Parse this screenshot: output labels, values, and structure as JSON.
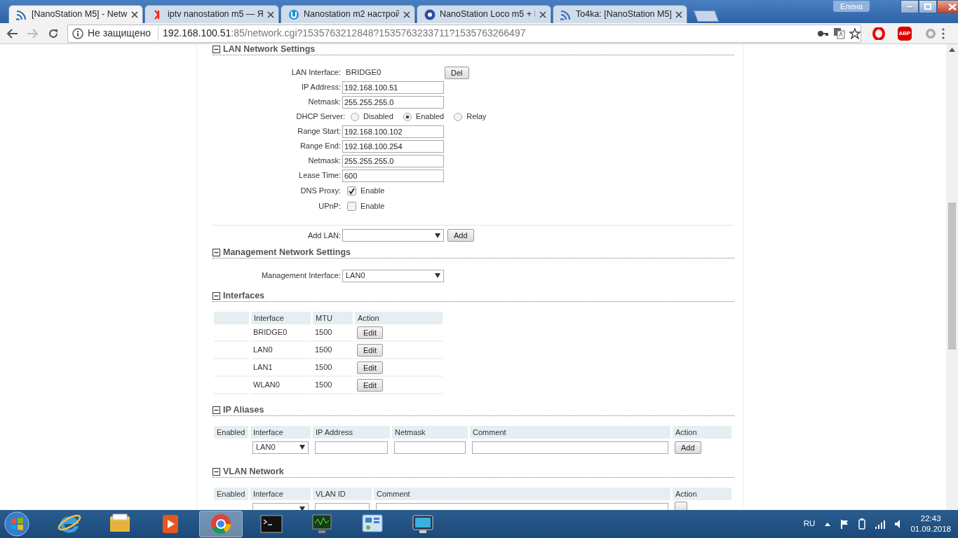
{
  "browser": {
    "tabs": [
      {
        "title": "[NanoStation M5] - Netw",
        "selected": true
      },
      {
        "title": "iptv nanostation m5 — Я",
        "selected": false
      },
      {
        "title": "Nanostation m2 настрой",
        "selected": false
      },
      {
        "title": "NanoStation Loco m5 + I",
        "selected": false
      },
      {
        "title": "To4ka: [NanoStation M5]",
        "selected": false
      }
    ],
    "user": "Елена",
    "address": {
      "security": "Не защищено",
      "host": "192.168.100.51",
      "path": ":85/network.cgi?1535763212848?1535763233711?1535763266497"
    },
    "extensions": [
      {
        "kind": "opera"
      },
      {
        "kind": "abp",
        "label": "ABP"
      },
      {
        "kind": "ghost"
      }
    ]
  },
  "sections": [
    {
      "title": "LAN Network Settings",
      "kind": "form",
      "expanded": true,
      "rows": [
        {
          "kind": "static",
          "label": "LAN Interface:",
          "value": "BRIDGE0",
          "button": "Del"
        },
        {
          "kind": "input",
          "label": "IP Address:",
          "value": "192.168.100.51"
        },
        {
          "kind": "input",
          "label": "Netmask:",
          "value": "255.255.255.0"
        },
        {
          "kind": "radio",
          "label": "DHCP Server:",
          "options": [
            {
              "label": "Disabled",
              "selected": false
            },
            {
              "label": "Enabled",
              "selected": true
            },
            {
              "label": "Relay",
              "selected": false
            }
          ]
        },
        {
          "kind": "input",
          "label": "Range Start:",
          "value": "192.168.100.102"
        },
        {
          "kind": "input",
          "label": "Range End:",
          "value": "192.168.100.254"
        },
        {
          "kind": "input",
          "label": "Netmask:",
          "value": "255.255.255.0"
        },
        {
          "kind": "input",
          "label": "Lease Time:",
          "value": "600"
        },
        {
          "kind": "checkbox",
          "label": "DNS Proxy:",
          "text": "Enable",
          "checked": true
        },
        {
          "kind": "checkbox",
          "label": "UPnP:",
          "text": "Enable",
          "checked": false
        },
        {
          "kind": "select",
          "label": "Add LAN:",
          "button": "Add",
          "separated": true
        }
      ]
    },
    {
      "title": "Management Network Settings",
      "kind": "form",
      "expanded": true,
      "rows": [
        {
          "kind": "select",
          "label": "Management Interface:",
          "value": "LAN0"
        }
      ]
    },
    {
      "title": "Interfaces",
      "kind": "interfaces",
      "expanded": true,
      "columns": [
        "",
        "Interface",
        "MTU",
        "Action"
      ],
      "rows": [
        {
          "cells": [
            {
              "kind": "spacer"
            },
            {
              "kind": "text",
              "text": "BRIDGE0"
            },
            {
              "kind": "text",
              "text": "1500"
            },
            {
              "kind": "button",
              "text": "Edit"
            }
          ]
        },
        {
          "cells": [
            {
              "kind": "spacer"
            },
            {
              "kind": "text",
              "text": "LAN0"
            },
            {
              "kind": "text",
              "text": "1500"
            },
            {
              "kind": "button",
              "text": "Edit"
            }
          ]
        },
        {
          "cells": [
            {
              "kind": "spacer"
            },
            {
              "kind": "text",
              "text": "LAN1"
            },
            {
              "kind": "text",
              "text": "1500"
            },
            {
              "kind": "button",
              "text": "Edit"
            }
          ]
        },
        {
          "cells": [
            {
              "kind": "spacer"
            },
            {
              "kind": "text",
              "text": "WLAN0"
            },
            {
              "kind": "text",
              "text": "1500"
            },
            {
              "kind": "button",
              "text": "Edit"
            }
          ]
        }
      ]
    },
    {
      "title": "IP Aliases",
      "kind": "aliases",
      "expanded": true,
      "columns": [
        "Enabled",
        "Interface",
        "IP Address",
        "Netmask",
        "Comment",
        "Action"
      ],
      "rows": [
        {
          "cells": [
            {
              "kind": "blank"
            },
            {
              "kind": "select",
              "text": "LAN0"
            },
            {
              "kind": "input"
            },
            {
              "kind": "input"
            },
            {
              "kind": "input"
            },
            {
              "kind": "button",
              "text": "Add"
            }
          ]
        }
      ]
    },
    {
      "title": "VLAN Network",
      "kind": "vlan",
      "expanded": true,
      "columns": [
        "Enabled",
        "Interface",
        "VLAN ID",
        "Comment",
        "Action"
      ],
      "rows": [
        {
          "cells": [
            {
              "kind": "blank"
            },
            {
              "kind": "select"
            },
            {
              "kind": "input"
            },
            {
              "kind": "input"
            },
            {
              "kind": "button"
            }
          ]
        }
      ]
    }
  ],
  "taskbar": {
    "apps": [
      {
        "kind": "ie",
        "selected": false
      },
      {
        "kind": "explorer",
        "selected": false
      },
      {
        "kind": "media",
        "selected": false
      },
      {
        "kind": "chrome",
        "selected": true
      },
      {
        "kind": "cmd",
        "selected": false
      },
      {
        "kind": "monitor",
        "selected": false
      },
      {
        "kind": "control",
        "selected": false
      },
      {
        "kind": "screen",
        "selected": false
      }
    ],
    "language": "RU",
    "time": "22:43",
    "date": "01.09.2018"
  }
}
